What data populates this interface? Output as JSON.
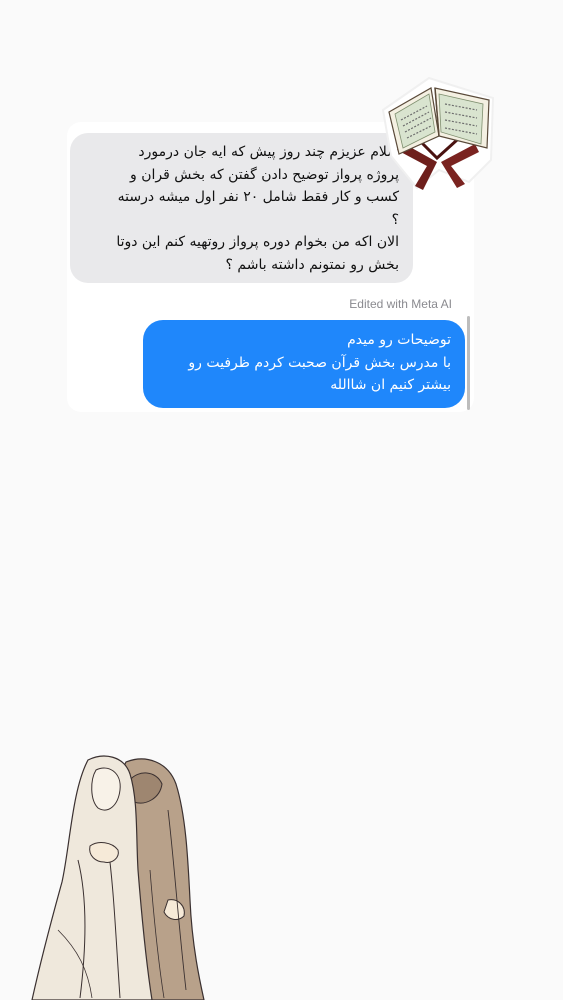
{
  "chat": {
    "incoming_message": "سلام عزیزم چند روز پیش که ایه جان درمورد\nپروژه پرواز توضیح دادن گفتن که بخش قران و\nکسب و کار فقط شامل ۲۰ نفر اول میشه  درسته\n؟\nالان اکه من بخوام دوره پرواز روتهیه کنم این دوتا\nبخش رو نمتونم داشته باشم ؟",
    "edited_label": "Edited with Meta AI",
    "outgoing_message": "توضیحات رو میدم\nبا مدرس بخش قرآن صحبت کردم ظرفیت رو\nبیشتر کنیم ان شاالله"
  },
  "decorations": {
    "sticker_icon": "open-quran-on-stand",
    "illustration_icon": "two-veiled-women-hugging"
  },
  "colors": {
    "outgoing_bubble": "#1f87fb",
    "incoming_bubble": "#e9e9eb",
    "background": "#fafafa"
  }
}
